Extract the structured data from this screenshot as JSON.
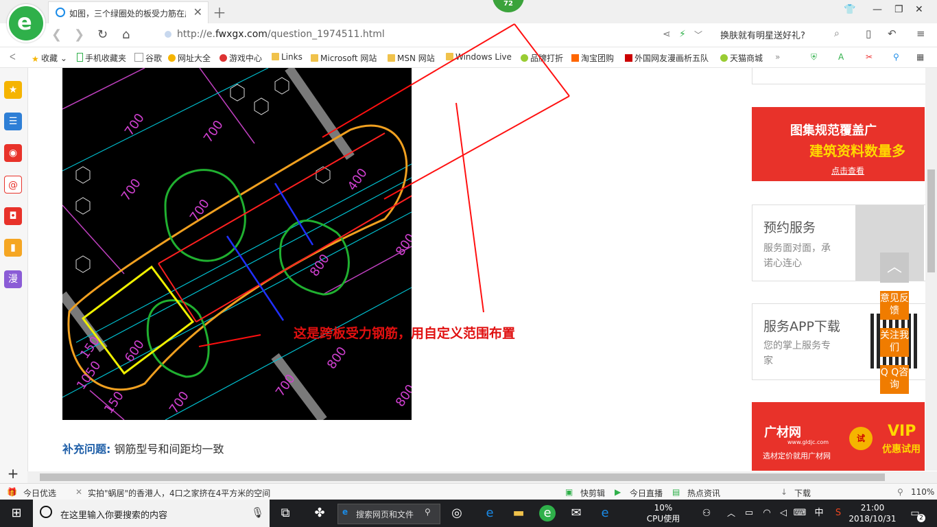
{
  "browser": {
    "tab_title": "如图，三个绿圈处的板受力筋在广联达",
    "badge_count": "72",
    "url_prefix": "http://e.",
    "url_domain": "fwxgx.com",
    "url_path": "/question_1974511.html",
    "search_hint": "换肤就有明星送好礼?"
  },
  "bookmarks": [
    {
      "label": "收藏",
      "icon": "star-icon"
    },
    {
      "label": "手机收藏夹",
      "icon": "phone-icon"
    },
    {
      "label": "谷歌",
      "icon": "page-icon"
    },
    {
      "label": "网址大全",
      "icon": "globe-icon"
    },
    {
      "label": "游戏中心",
      "icon": "game-icon"
    },
    {
      "label": "Links",
      "icon": "folder-icon"
    },
    {
      "label": "Microsoft 网站",
      "icon": "folder-icon"
    },
    {
      "label": "MSN 网站",
      "icon": "folder-icon"
    },
    {
      "label": "Windows Live",
      "icon": "folder-icon"
    },
    {
      "label": "品牌打折",
      "icon": "leaf-icon"
    },
    {
      "label": "淘宝团购",
      "icon": "taobao-icon"
    },
    {
      "label": "外国网友漫画析五队",
      "icon": "bookmark-icon"
    },
    {
      "label": "天猫商城",
      "icon": "leaf-icon"
    }
  ],
  "content": {
    "annotation_text": "这是跨板受力钢筋，用自定义范围布置",
    "supplement_label": "补充问题:",
    "supplement_text": "钢筋型号和间距均一致"
  },
  "ads": {
    "banner1_line1": "图集规范覆盖广",
    "banner1_line2": "建筑资料数量多",
    "banner1_cta": "点击查看",
    "service_title": "预约服务",
    "service_sub1": "服务面对面，承",
    "service_sub2": "诺心连心",
    "app_title": "服务APP下载",
    "app_sub1": "您的掌上服务专",
    "app_sub2": "家",
    "banner2_brand": "广材网",
    "banner2_domain": "www.gldjc.com",
    "banner2_slogan": "选材定价就用广材网",
    "banner2_try": "试",
    "banner2_vip": "VIP",
    "banner2_vip_sub": "优惠试用"
  },
  "float_buttons": {
    "feedback": "意见反馈",
    "follow": "关注我们",
    "qq": "Q Q咨询"
  },
  "statusbar": {
    "today_pick": "今日优选",
    "news": "实拍\"蜗居\"的香港人，4口之家挤在4平方米的空间",
    "clip": "快剪辑",
    "live": "今日直播",
    "hot": "热点资讯",
    "download": "下载",
    "zoom": "110%"
  },
  "taskbar": {
    "search_placeholder": "在这里输入你要搜索的内容",
    "web_search": "搜索网页和文件",
    "cpu_percent": "10%",
    "cpu_label": "CPU使用",
    "ime": "中",
    "time": "21:00",
    "date": "2018/10/31",
    "notifications": "2"
  },
  "cad_labels": [
    "700",
    "700",
    "700",
    "700",
    "700",
    "400",
    "800",
    "800",
    "800",
    "700",
    "600",
    "150",
    "1050",
    "150",
    "700",
    "700",
    "800"
  ],
  "colors": {
    "accent_green": "#2fb04a",
    "orange": "#f07c00",
    "red_banner": "#e8322a",
    "link_blue": "#1f5fa8"
  }
}
